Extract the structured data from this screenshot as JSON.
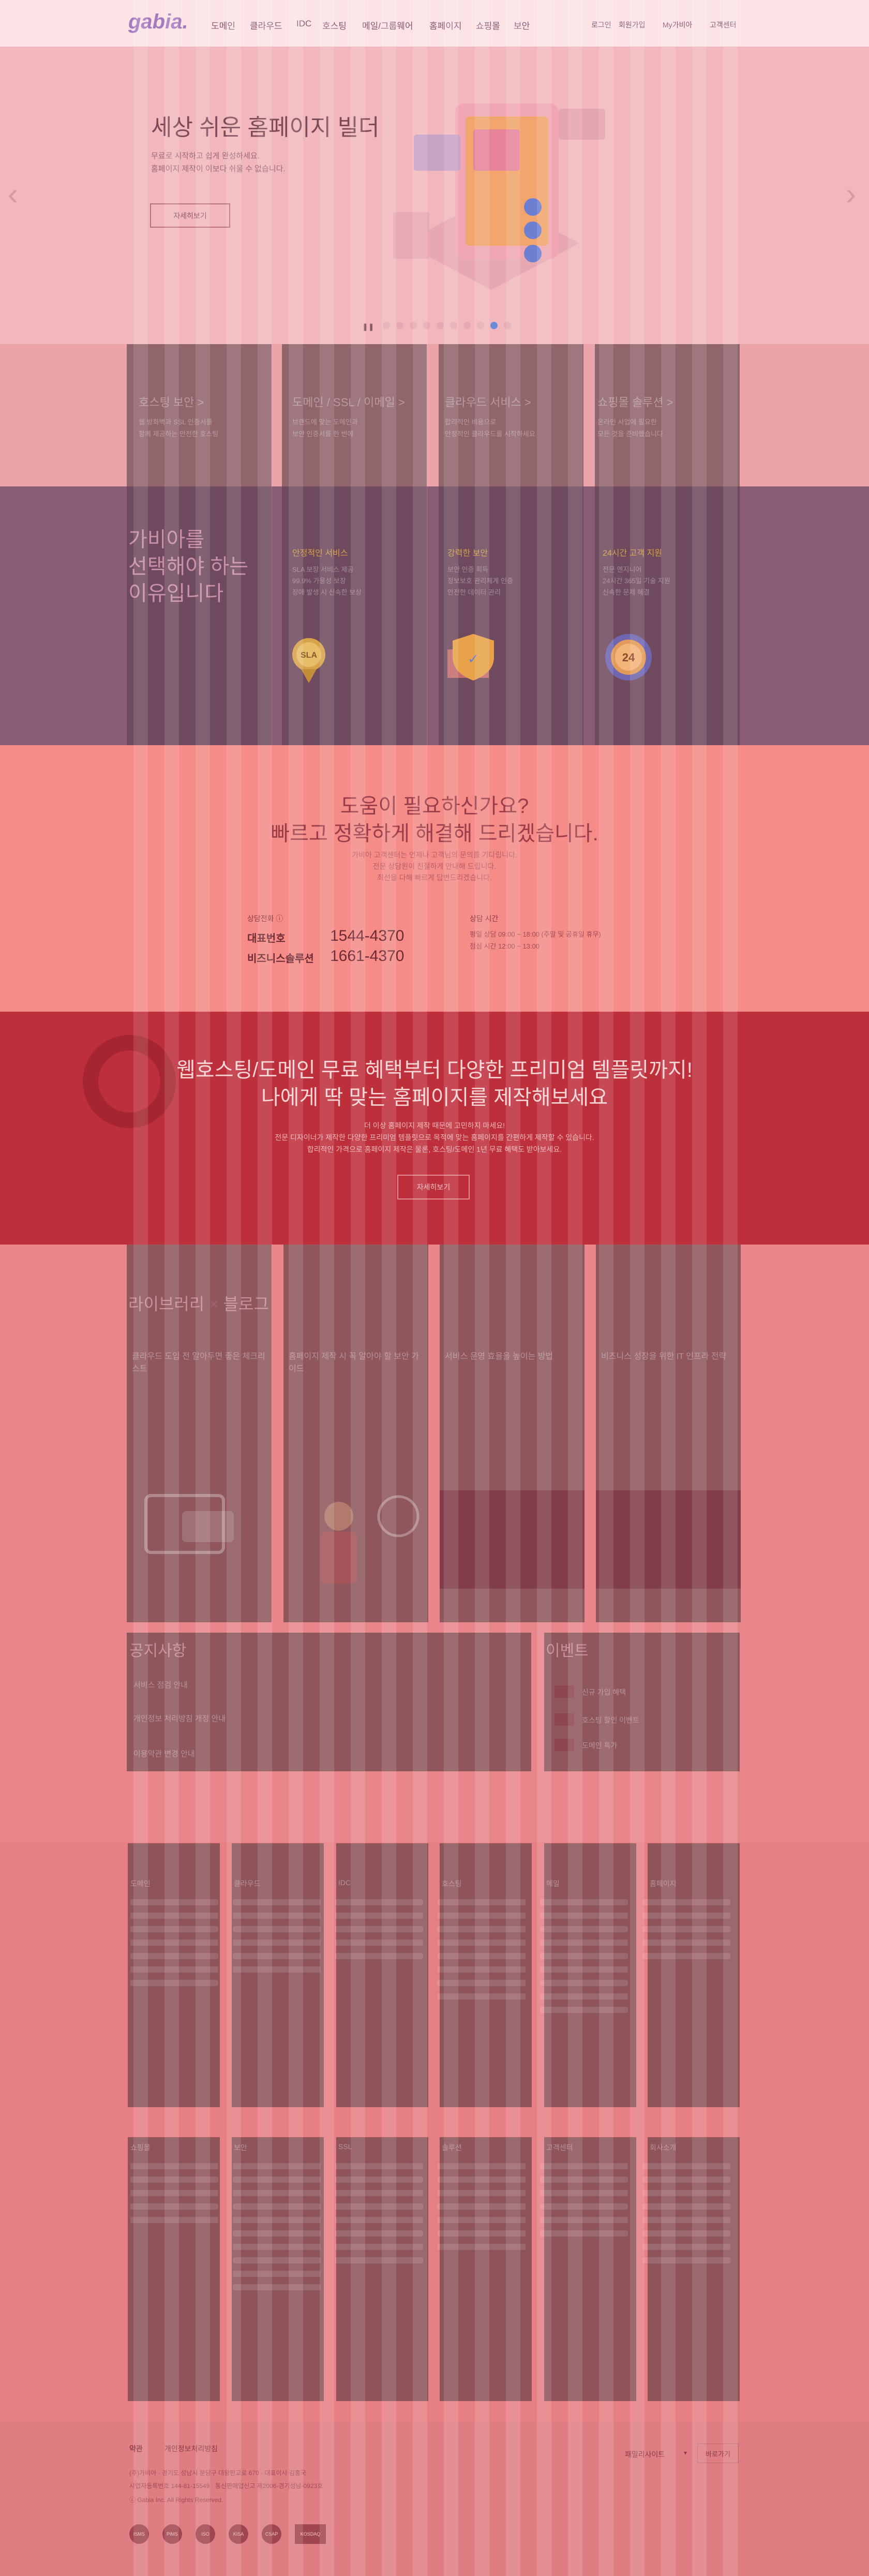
{
  "header": {
    "logo": "gabia.",
    "nav": [
      "도메인",
      "클라우드",
      "IDC",
      "호스팅",
      "메일/그룹웨어",
      "홈페이지",
      "쇼핑몰",
      "보안"
    ],
    "util": [
      "로그인",
      "회원가입",
      "My가비아",
      "고객센터"
    ]
  },
  "hero": {
    "title": "세상 쉬운 홈페이지 빌더",
    "desc1": "무료로 시작하고 쉽게 완성하세요.",
    "desc2": "홈페이지 제작이 이보다 쉬울 수 없습니다.",
    "button": "자세히보기",
    "pause": "❚❚",
    "prev": "‹",
    "next": "›"
  },
  "quick": [
    {
      "title": "호스팅 보안 >",
      "l1": "웹 방화벽과 SSL 인증서를",
      "l2": "함께 제공하는 안전한 호스팅"
    },
    {
      "title": "도메인 / SSL / 이메일 >",
      "l1": "브랜드에 맞는 도메인과",
      "l2": "보안 인증서를 한 번에"
    },
    {
      "title": "클라우드 서비스 >",
      "l1": "합리적인 비용으로",
      "l2": "안정적인 클라우드를 시작하세요"
    },
    {
      "title": "쇼핑몰 솔루션 >",
      "l1": "온라인 사업에 필요한",
      "l2": "모든 것을 준비했습니다"
    }
  ],
  "why": {
    "heading1": "가비아를",
    "heading2": "선택해야 하는",
    "heading3": "이유입니다",
    "items": [
      {
        "title": "안정적인 서비스",
        "l1": "SLA 보장 서비스 제공",
        "l2": "99.9% 가용성 보장",
        "l3": "장애 발생 시 신속한 보상",
        "badge": "SLA"
      },
      {
        "title": "강력한 보안",
        "l1": "보안 인증 획득",
        "l2": "정보보호 관리체계 인증",
        "l3": "안전한 데이터 관리",
        "badge": "✓"
      },
      {
        "title": "24시간 고객 지원",
        "l1": "전문 엔지니어",
        "l2": "24시간 365일 기술 지원",
        "l3": "신속한 문제 해결",
        "badge": "24"
      }
    ]
  },
  "help": {
    "title1": "도움이 필요하신가요?",
    "title2": "빠르고 정확하게 해결해 드리겠습니다.",
    "d1": "가비아 고객센터는 언제나 고객님의 문의를 기다립니다.",
    "d2": "전문 상담원이 친절하게 안내해 드립니다.",
    "d3": "최선을 다해 빠르게 답변드리겠습니다.",
    "phone_label": "상담전화 ⓘ",
    "rep_label": "대표번호",
    "rep_num": "1544-4370",
    "biz_label": "비즈니스솔루션",
    "biz_num": "1661-4370",
    "hours_label": "상담 시간",
    "hours1": "평일 상담 09:00 ~ 18:00 (주말 및 공휴일 휴무)",
    "hours2": "점심 시간 12:00 ~ 13:00"
  },
  "promo": {
    "title1": "웹호스팅/도메인 무료 혜택부터 다양한 프리미엄 템플릿까지!",
    "title2": "나에게 딱 맞는 홈페이지를 제작해보세요",
    "d1": "더 이상 홈페이지 제작 때문에 고민하지 마세요!",
    "d2": "전문 디자이너가 제작한 다양한 프리미엄 템플릿으로 목적에 맞는 홈페이지를 간편하게 제작할 수 있습니다.",
    "d3": "합리적인 가격으로 홈페이지 제작은 물론, 호스팅/도메인 1년 무료 혜택도 받아보세요.",
    "button": "자세히보기"
  },
  "library": {
    "title1": "라이브러리",
    "title2": "블로그",
    "cards": [
      {
        "title": "클라우드 도입 전 알아두면 좋은 체크리스트"
      },
      {
        "title": "홈페이지 제작 시 꼭 알아야 할 보안 가이드"
      },
      {
        "title": "서비스 운영 효율을 높이는 방법"
      },
      {
        "title": "비즈니스 성장을 위한 IT 인프라 전략"
      }
    ]
  },
  "notice": {
    "title": "공지사항",
    "items": [
      "서비스 점검 안내",
      "개인정보 처리방침 개정 안내",
      "이용약관 변경 안내"
    ]
  },
  "event": {
    "title": "이벤트",
    "items": [
      "신규 가입 혜택",
      "호스팅 할인 이벤트",
      "도메인 특가"
    ]
  },
  "footer": {
    "col_titles1": [
      "도메인",
      "클라우드",
      "IDC",
      "호스팅",
      "메일",
      "홈페이지"
    ],
    "col_titles2": [
      "쇼핑몰",
      "보안",
      "SSL",
      "솔루션",
      "고객센터",
      "회사소개"
    ],
    "links": [
      "약관",
      "개인정보처리방침"
    ],
    "family": "패밀리사이트",
    "family_btn": "바로가기",
    "copy": "ⓒ Gabia Inc. All Rights Reserved.",
    "addr": "(주)가비아 · 경기도 성남시 분당구 대왕판교로 670 · 대표이사 김홍국",
    "biz": "사업자등록번호 144-81-15549 · 통신판매업신고 제2006-경기성남-0923호",
    "badges": [
      "ISMS",
      "PIMS",
      "ISO",
      "KISA",
      "CSAP",
      "KOSDAQ"
    ]
  }
}
